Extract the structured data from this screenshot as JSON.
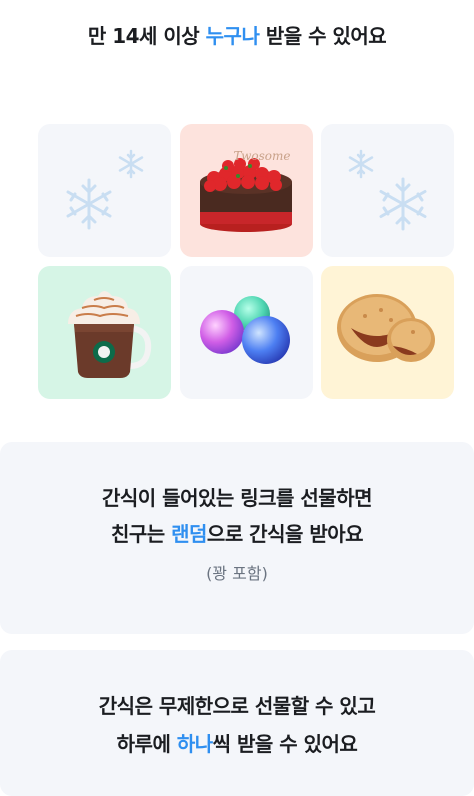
{
  "headline": {
    "prefix": "만 14세 이상 ",
    "highlight": "누구나",
    "suffix": " 받을 수 있어요"
  },
  "tiles": [
    {
      "name": "snowflake-decoration",
      "icon": "snowflake-icon"
    },
    {
      "name": "strawberry-cake",
      "icon": "strawberry-cake-image",
      "cake_text": "Twosome"
    },
    {
      "name": "snowflake-decoration",
      "icon": "snowflake-icon"
    },
    {
      "name": "starbucks-hot-chocolate",
      "icon": "hot-chocolate-image"
    },
    {
      "name": "color-marbles",
      "icon": "marbles-image"
    },
    {
      "name": "meat-pie",
      "icon": "pie-image"
    }
  ],
  "card1": {
    "line1": "간식이 들어있는 링크를 선물하면",
    "line2_prefix": "친구는 ",
    "line2_highlight": "랜덤",
    "line2_suffix": "으로 간식을 받아요",
    "note": "(꽝 포함)"
  },
  "card2": {
    "line1": "간식은 무제한으로 선물할 수 있고",
    "line2_prefix": "하루에 ",
    "line2_highlight": "하나",
    "line2_suffix": "씩 받을 수 있어요"
  },
  "colors": {
    "accent": "#2f8ff0",
    "text": "#1b1d21",
    "card_bg": "#f4f6fa",
    "note": "#6b7481"
  }
}
